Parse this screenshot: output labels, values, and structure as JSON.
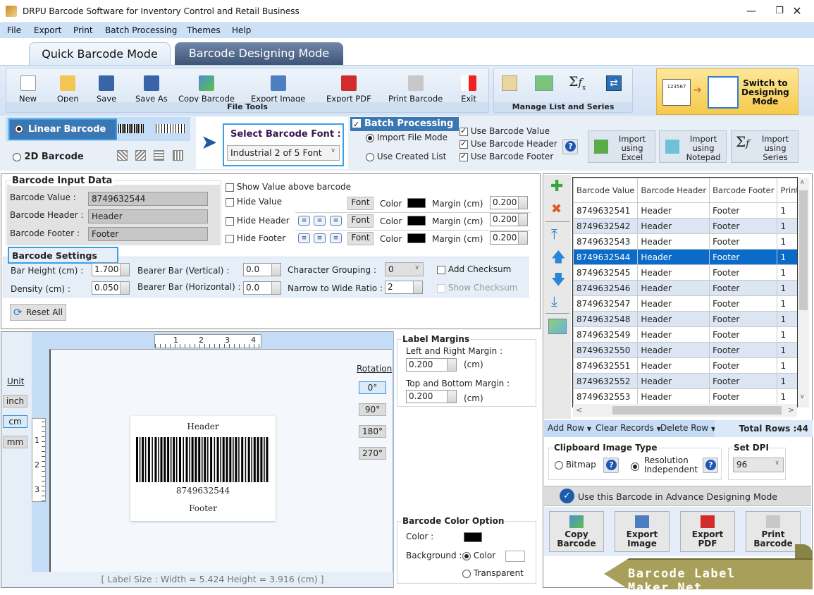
{
  "window": {
    "title": "DRPU Barcode Software for Inventory Control and Retail Business",
    "minimize_icon": "minimize-icon",
    "restore_icon": "restore-icon",
    "close_icon": "close-icon"
  },
  "menu": [
    "File",
    "Export",
    "Print",
    "Batch Processing",
    "Themes",
    "Help"
  ],
  "tabs": [
    {
      "label": "Quick Barcode Mode",
      "active": true
    },
    {
      "label": "Barcode Designing Mode",
      "active": false
    }
  ],
  "file_tools": {
    "group_label": "File Tools",
    "buttons": [
      {
        "label": "New",
        "icon": "new-file-icon"
      },
      {
        "label": "Open",
        "icon": "open-folder-icon"
      },
      {
        "label": "Save",
        "icon": "save-icon"
      },
      {
        "label": "Save As",
        "icon": "save-as-icon"
      },
      {
        "label": "Copy Barcode",
        "icon": "copy-barcode-icon"
      },
      {
        "label": "Export Image",
        "icon": "export-image-icon"
      },
      {
        "label": "Export PDF",
        "icon": "pdf-icon"
      },
      {
        "label": "Print Barcode",
        "icon": "printer-icon"
      },
      {
        "label": "Exit",
        "icon": "exit-icon"
      }
    ]
  },
  "manage_list": {
    "group_label": "Manage List and Series",
    "icons": [
      "edit-list-icon",
      "excel-export-icon",
      "sigma-fx-icon",
      "swap-arrows-icon"
    ]
  },
  "switch_mode": {
    "label_line1": "Switch to",
    "label_line2": "Designing",
    "label_line3": "Mode",
    "sample_value": "123567"
  },
  "barcode_type": {
    "linear_label": "Linear Barcode",
    "twod_label": "2D Barcode",
    "selected": "Linear Barcode"
  },
  "font_select": {
    "label": "Select Barcode Font :",
    "value": "Industrial 2 of 5 Font"
  },
  "batch": {
    "label": "Batch Processing",
    "checked": true,
    "modes": [
      {
        "label": "Import File Mode",
        "selected": true
      },
      {
        "label": "Use Created List",
        "selected": false
      }
    ],
    "options": [
      {
        "label": "Use Barcode Value",
        "checked": true
      },
      {
        "label": "Use Barcode Header",
        "checked": true
      },
      {
        "label": "Use Barcode Footer",
        "checked": true
      }
    ],
    "import_buttons": [
      {
        "line1": "Import",
        "line2": "using",
        "line3": "Excel",
        "icon": "excel-icon"
      },
      {
        "line1": "Import",
        "line2": "using",
        "line3": "Notepad",
        "icon": "notepad-icon"
      },
      {
        "line1": "Import",
        "line2": "using",
        "line3": "Series",
        "icon": "sigma-fx-icon"
      }
    ]
  },
  "input_data": {
    "title": "Barcode Input Data",
    "value_label": "Barcode Value :",
    "value": "8749632544",
    "header_label": "Barcode Header :",
    "header": "Header",
    "footer_label": "Barcode Footer :",
    "footer": "Footer"
  },
  "display_options": {
    "show_value_above": {
      "label": "Show Value above barcode",
      "checked": false
    },
    "hide_value": {
      "label": "Hide Value",
      "checked": false
    },
    "hide_header": {
      "label": "Hide Header",
      "checked": false
    },
    "hide_footer": {
      "label": "Hide Footer",
      "checked": false
    },
    "font_label": "Font",
    "color_label": "Color",
    "margin_label": "Margin (cm)",
    "value_margin": "0.200",
    "header_margin": "0.200",
    "footer_margin": "0.200",
    "text_color": "#000000"
  },
  "settings": {
    "title": "Barcode Settings",
    "bar_height_label": "Bar Height (cm) :",
    "bar_height": "1.700",
    "density_label": "Density (cm) :",
    "density": "0.050",
    "bearer_v_label": "Bearer Bar (Vertical) :",
    "bearer_v": "0.0",
    "bearer_h_label": "Bearer Bar (Horizontal) :",
    "bearer_h": "0.0",
    "char_group_label": "Character Grouping  :",
    "char_group": "0",
    "ratio_label": "Narrow to Wide Ratio :",
    "ratio": "2",
    "add_checksum": {
      "label": "Add Checksum",
      "checked": false
    },
    "show_checksum": {
      "label": "Show Checksum",
      "checked": false,
      "disabled": true
    },
    "reset_label": "Reset All"
  },
  "preview": {
    "unit_label": "Unit",
    "units": [
      "inch",
      "cm",
      "mm"
    ],
    "active_unit": "cm",
    "ruler_h": [
      "1",
      "2",
      "3",
      "4"
    ],
    "ruler_v": [
      "1",
      "2",
      "3"
    ],
    "header": "Header",
    "value": "8749632544",
    "footer": "Footer",
    "rotation_label": "Rotation",
    "rotations": [
      "0°",
      "90°",
      "180°",
      "270°"
    ],
    "active_rotation": "0°",
    "label_size": "[ Label Size : Width = 5.424  Height = 3.916 (cm) ]"
  },
  "label_margins": {
    "title": "Label Margins",
    "lr_label": "Left and Right Margin :",
    "lr_value": "0.200",
    "tb_label": "Top and Bottom Margin :",
    "tb_value": "0.200",
    "unit": "(cm)"
  },
  "color_option": {
    "title": "Barcode Color Option",
    "color_label": "Color :",
    "bar_color": "#000000",
    "background_label": "Background :",
    "bg_color_label": "Color",
    "bg_transparent_label": "Transparent",
    "bg_mode": "Color",
    "bg_color": "#ffffff"
  },
  "list": {
    "side_icons": [
      "add-row-icon",
      "delete-row-icon",
      "move-top-icon",
      "move-up-icon",
      "move-down-icon",
      "move-bottom-icon",
      "export-excel-icon"
    ],
    "columns": [
      "Barcode Value",
      "Barcode Header",
      "Barcode Footer",
      "Print Quantity"
    ],
    "rows": [
      [
        "8749632541",
        "Header",
        "Footer",
        "1"
      ],
      [
        "8749632542",
        "Header",
        "Footer",
        "1"
      ],
      [
        "8749632543",
        "Header",
        "Footer",
        "1"
      ],
      [
        "8749632544",
        "Header",
        "Footer",
        "1"
      ],
      [
        "8749632545",
        "Header",
        "Footer",
        "1"
      ],
      [
        "8749632546",
        "Header",
        "Footer",
        "1"
      ],
      [
        "8749632547",
        "Header",
        "Footer",
        "1"
      ],
      [
        "8749632548",
        "Header",
        "Footer",
        "1"
      ],
      [
        "8749632549",
        "Header",
        "Footer",
        "1"
      ],
      [
        "8749632550",
        "Header",
        "Footer",
        "1"
      ],
      [
        "8749632551",
        "Header",
        "Footer",
        "1"
      ],
      [
        "8749632552",
        "Header",
        "Footer",
        "1"
      ],
      [
        "8749632553",
        "Header",
        "Footer",
        "1"
      ]
    ],
    "selected_index": 3,
    "add_row": "Add Row",
    "clear_records": "Clear Records",
    "delete_row": "Delete Row",
    "total_rows": "Total Rows :44"
  },
  "clipboard": {
    "title": "Clipboard Image Type",
    "bitmap": "Bitmap",
    "resolution_line1": "Resolution",
    "resolution_line2": "Independent",
    "selected": "Resolution Independent"
  },
  "dpi": {
    "title": "Set DPI",
    "value": "96"
  },
  "advance_label": "Use this Barcode in Advance Designing Mode",
  "action_buttons": [
    {
      "line1": "Copy",
      "line2": "Barcode",
      "icon": "copy-barcode-icon"
    },
    {
      "line1": "Export",
      "line2": "Image",
      "icon": "export-image-icon"
    },
    {
      "line1": "Export",
      "line2": "PDF",
      "icon": "pdf-icon"
    },
    {
      "line1": "Print",
      "line2": "Barcode",
      "icon": "printer-icon"
    }
  ],
  "watermark": "Barcode Label Maker.Net",
  "colors": {
    "accent": "#3b77b2",
    "selection": "#0a6bc9",
    "highlight_border": "#3aa0e6"
  }
}
